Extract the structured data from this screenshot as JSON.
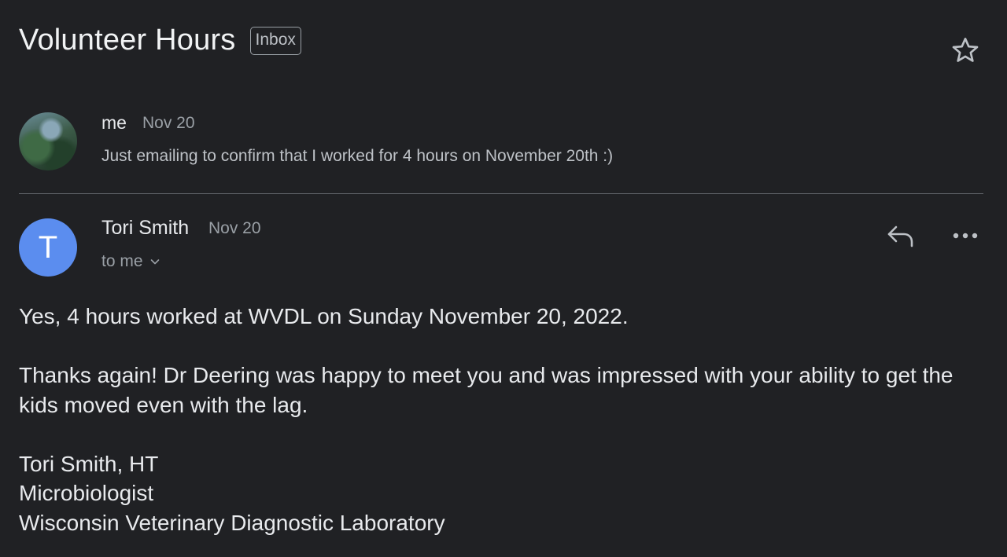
{
  "thread": {
    "subject": "Volunteer Hours",
    "label": "Inbox",
    "star_icon": "star-outline-icon"
  },
  "messages": [
    {
      "sender": "me",
      "date": "Nov 20",
      "snippet": "Just emailing to confirm that I worked for 4 hours on November 20th :)",
      "avatar": "photo"
    },
    {
      "sender": "Tori Smith",
      "date": "Nov 20",
      "avatar_letter": "T",
      "avatar_color": "#5b8def",
      "recipients": "to me",
      "body": {
        "para1": "Yes, 4 hours worked at WVDL on Sunday November 20, 2022.",
        "para2": "Thanks again! Dr Deering was happy to meet you and was impressed with your ability to get the kids moved even with the lag.",
        "signature": {
          "line1": "Tori Smith, HT",
          "line2": "Microbiologist",
          "line3": "Wisconsin Veterinary Diagnostic Laboratory"
        }
      }
    }
  ],
  "colors": {
    "background": "#202124",
    "text_primary": "#e8eaed",
    "text_secondary": "#9aa0a6",
    "divider": "#5f6368"
  }
}
